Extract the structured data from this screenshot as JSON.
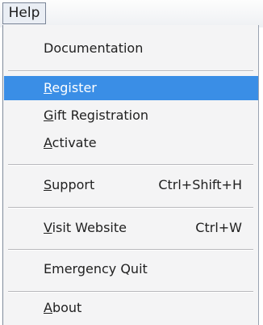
{
  "menubar": {
    "help_label": "Help"
  },
  "menu": {
    "documentation": "Documentation",
    "register": {
      "mnemonic": "R",
      "rest": "egister"
    },
    "gift_registration": {
      "mnemonic": "G",
      "rest": "ift Registration"
    },
    "activate": {
      "mnemonic": "A",
      "rest": "ctivate"
    },
    "support": {
      "mnemonic": "S",
      "rest": "upport",
      "shortcut": "Ctrl+Shift+H"
    },
    "visit_website": {
      "mnemonic": "V",
      "rest": "isit Website",
      "shortcut": "Ctrl+W"
    },
    "emergency_quit": "Emergency Quit",
    "about": {
      "mnemonic": "A",
      "rest": "bout"
    }
  },
  "colors": {
    "highlight": "#3a8ee6",
    "menu_background": "#f4f4f5"
  }
}
